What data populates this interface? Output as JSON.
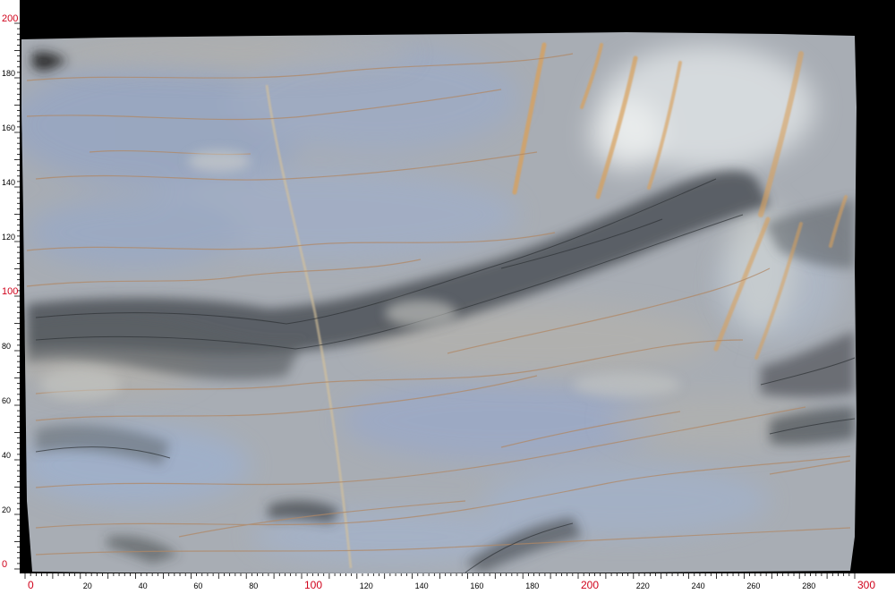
{
  "image": {
    "subject": "marble-slab",
    "background_color": "#000000",
    "ruler_color": "#ffffff",
    "major_label_color": "#d0021b",
    "minor_label_color": "#000000",
    "slab_base_color": "#a9adb3"
  },
  "ruler_x": {
    "min": 0,
    "max": 300,
    "labels": [
      {
        "value": 0,
        "text": "0",
        "major": true
      },
      {
        "value": 20,
        "text": "20",
        "major": false
      },
      {
        "value": 40,
        "text": "40",
        "major": false
      },
      {
        "value": 60,
        "text": "60",
        "major": false
      },
      {
        "value": 80,
        "text": "80",
        "major": false
      },
      {
        "value": 100,
        "text": "100",
        "major": true
      },
      {
        "value": 120,
        "text": "120",
        "major": false
      },
      {
        "value": 140,
        "text": "140",
        "major": false
      },
      {
        "value": 160,
        "text": "160",
        "major": false
      },
      {
        "value": 180,
        "text": "180",
        "major": false
      },
      {
        "value": 200,
        "text": "200",
        "major": true
      },
      {
        "value": 220,
        "text": "220",
        "major": false
      },
      {
        "value": 240,
        "text": "240",
        "major": false
      },
      {
        "value": 260,
        "text": "260",
        "major": false
      },
      {
        "value": 280,
        "text": "280",
        "major": false
      },
      {
        "value": 300,
        "text": "300",
        "major": true
      }
    ]
  },
  "ruler_y": {
    "min": 0,
    "max": 200,
    "labels": [
      {
        "value": 0,
        "text": "0",
        "major": true
      },
      {
        "value": 20,
        "text": "20",
        "major": false
      },
      {
        "value": 40,
        "text": "40",
        "major": false
      },
      {
        "value": 60,
        "text": "60",
        "major": false
      },
      {
        "value": 80,
        "text": "80",
        "major": false
      },
      {
        "value": 100,
        "text": "100",
        "major": true
      },
      {
        "value": 120,
        "text": "120",
        "major": false
      },
      {
        "value": 140,
        "text": "140",
        "major": false
      },
      {
        "value": 160,
        "text": "160",
        "major": false
      },
      {
        "value": 180,
        "text": "180",
        "major": false
      },
      {
        "value": 200,
        "text": "200",
        "major": true
      }
    ]
  }
}
